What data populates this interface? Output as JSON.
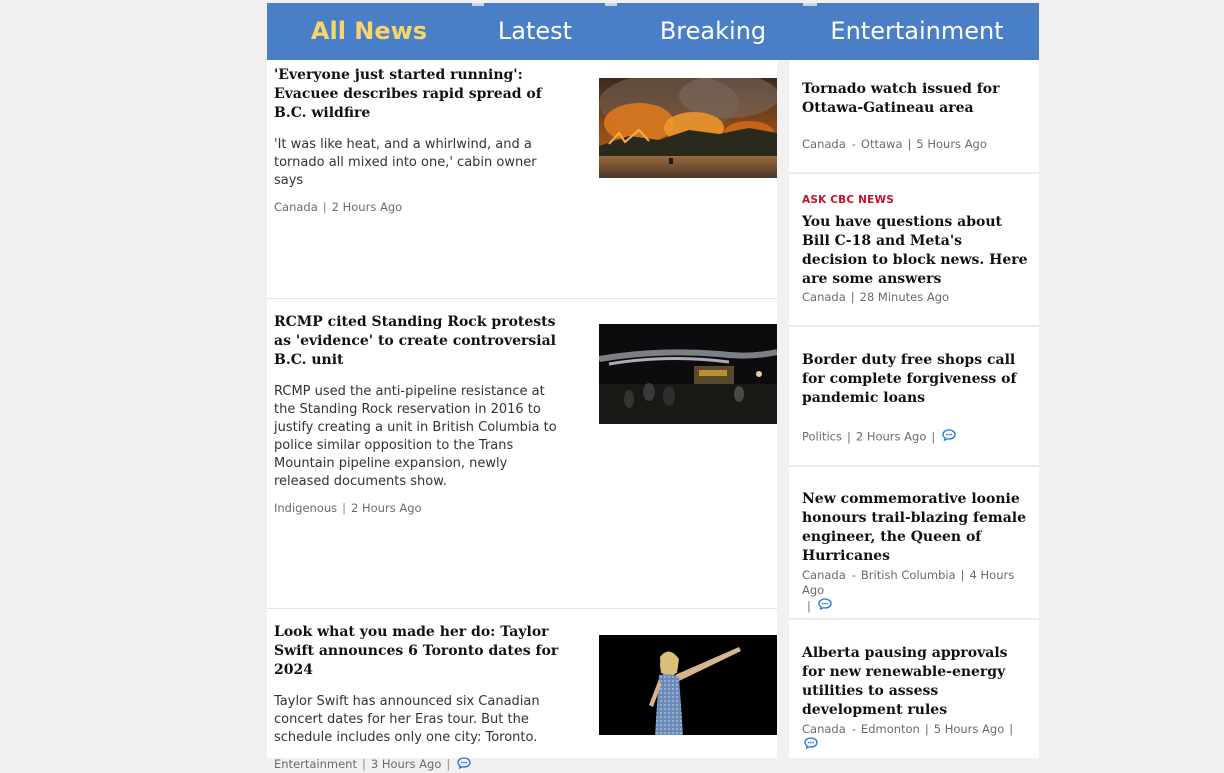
{
  "tabs": [
    {
      "label": "All News",
      "active": true
    },
    {
      "label": "Latest",
      "active": false
    },
    {
      "label": "Breaking",
      "active": false
    },
    {
      "label": "Entertainment",
      "active": false
    }
  ],
  "main_stories": [
    {
      "headline": "'Everyone just started running': Evacuee describes rapid spread of B.C. wildfire",
      "deck": "'It was like heat, and a whirlwind, and a tornado all mixed into one,' cabin owner says",
      "section": "Canada",
      "time": "2 Hours Ago",
      "image": "wildfire-photo"
    },
    {
      "headline": "RCMP cited Standing Rock protests as 'evidence' to create controversial B.C. unit",
      "deck": "RCMP used the anti-pipeline resistance at the Standing Rock reservation in 2016 to justify creating a unit in British Columbia to police similar opposition to the Trans Mountain pipeline expansion, newly released documents show.",
      "section": "Indigenous",
      "time": "2 Hours Ago",
      "image": "standing-rock-photo"
    },
    {
      "headline": "Look what you made her do: Taylor Swift announces 6 Toronto dates for 2024",
      "deck": "Taylor Swift has announced six Canadian concert dates for her Eras tour. But the schedule includes only one city: Toronto.",
      "section": "Entertainment",
      "time": "3 Hours Ago",
      "image": "taylor-swift-photo",
      "comments_icon": "comment-icon"
    }
  ],
  "side_stories": [
    {
      "headline": "Tornado watch issued for Ottawa-Gatineau area",
      "section": "Canada",
      "subsection": "Ottawa",
      "time": "5 Hours Ago"
    },
    {
      "eyebrow": "ASK CBC NEWS",
      "headline": "You have questions about Bill C-18 and Meta's decision to block news. Here are some answers",
      "section": "Canada",
      "time": "28 Minutes Ago"
    },
    {
      "headline": "Border duty free shops call for complete forgiveness of pandemic loans",
      "section": "Politics",
      "time": "2 Hours Ago",
      "comments_icon": "comment-icon"
    },
    {
      "headline": "New commemorative loonie honours trail-blazing female engineer, the Queen of Hurricanes",
      "section": "Canada",
      "subsection": "British Columbia",
      "time": "4 Hours Ago",
      "comments_icon": "comment-icon"
    },
    {
      "headline": "Alberta pausing approvals for new renewable-energy utilities to assess development rules",
      "section": "Canada",
      "subsection": "Edmonton",
      "time": "5 Hours Ago",
      "comments_icon": "comment-icon"
    }
  ],
  "meta_separator": "|",
  "subsection_dash": "-",
  "colors": {
    "tab_bar": "#4a7fc8",
    "tab_active": "#f8d56b",
    "eyebrow_red": "#c8102e",
    "comment_blue": "#1a73e8"
  }
}
